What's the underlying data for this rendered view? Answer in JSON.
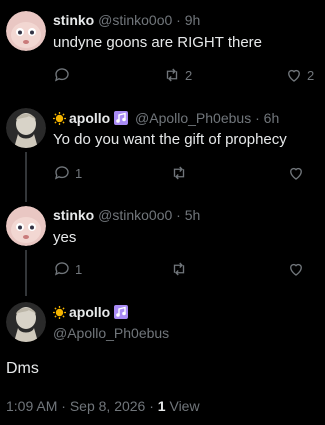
{
  "tweets": [
    {
      "name": "stinko",
      "handle": "@stinko0o0",
      "time": "9h",
      "text": "undyne goons are RIGHT there",
      "replies": "",
      "retweets": "2",
      "likes": "2"
    },
    {
      "name": "apollo",
      "name_suffix_icon": "music-note-icon",
      "name_prefix_icon": "sun-icon",
      "handle": "@Apollo_Ph0ebus",
      "time": "6h",
      "text": "Yo do you want the gift of prophecy",
      "replies": "1",
      "retweets": "",
      "likes": ""
    },
    {
      "name": "stinko",
      "handle": "@stinko0o0",
      "time": "5h",
      "text": "yes",
      "replies": "1",
      "retweets": "",
      "likes": ""
    }
  ],
  "main_tweet": {
    "name": "apollo",
    "handle": "@Apollo_Ph0ebus",
    "text": "Dms",
    "time": "1:09 AM",
    "date": "Sep 8, 2026",
    "views_count": "1",
    "views_label": "View",
    "sep": "·"
  },
  "colors": {
    "background": "#000000",
    "text": "#e7e9ea",
    "muted": "#71767b",
    "sun": "#f4b400",
    "music_note": "#a98bf5"
  }
}
